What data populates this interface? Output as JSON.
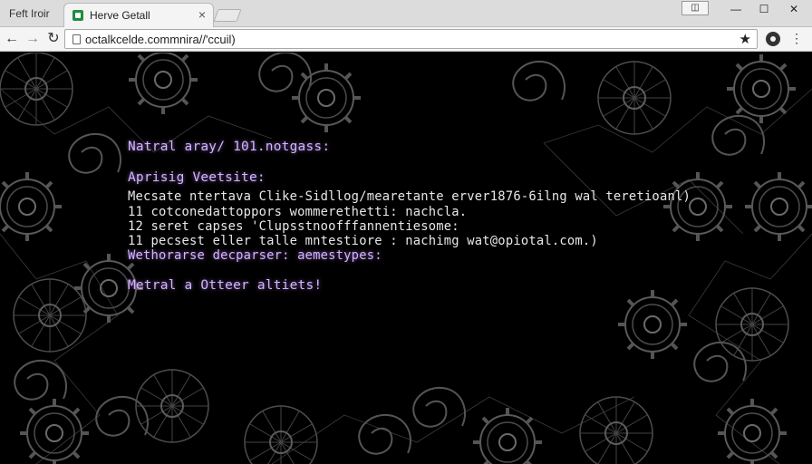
{
  "browser": {
    "app_label": "Feft Iroir",
    "tab": {
      "title": "Herve Getall",
      "close_icon": "×"
    },
    "window_controls": {
      "user": "◫",
      "minimize": "—",
      "maximize": "☐",
      "close": "✕"
    },
    "nav": {
      "back": "←",
      "forward": "→",
      "reload": "↻"
    },
    "address": "octalkcelde.commnira//'ccuil)",
    "star_icon": "★",
    "menu_icon": "⋮",
    "icons": [
      "favicon-icon",
      "close-icon",
      "back-arrow-icon",
      "forward-arrow-icon",
      "reload-icon",
      "page-icon",
      "star-icon",
      "extension-icon",
      "menu-icon"
    ]
  },
  "terminal": {
    "heading": "Natral aray/ 101.notgass:",
    "subheading": "Aprisig Veetsite:",
    "lines": [
      "Mecsate ntertava Clike-Sidllog/mearetante erver1876-6ilng wal teretioanl)",
      "11 cotconedattoppors wommerethetti: nachcla.",
      "12 seret capses 'Clupsstnoofffannentiesome:",
      "11 pecsest eller talle mntestiore : nachimg wat@opiotal.com.)"
    ],
    "highlight": "Wethorarse decparser: aemestypes:",
    "footer": "Metral a Otteer altiets!"
  },
  "colors": {
    "accent_violet": "#d3b2ff",
    "text_white": "#e8e8e8",
    "background": "#000000",
    "chrome": "#dcdcdc"
  }
}
